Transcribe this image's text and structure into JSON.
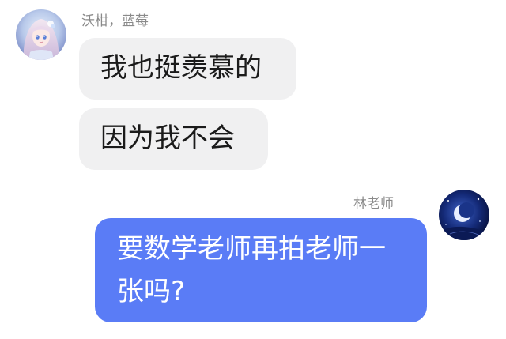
{
  "left_user": {
    "name": "沃柑，蓝莓",
    "avatar_icon": "anime-girl-avatar-icon"
  },
  "right_user": {
    "name": "林老师",
    "avatar_icon": "moon-night-avatar-icon"
  },
  "messages": [
    {
      "side": "left",
      "text": "我也挺羡慕的"
    },
    {
      "side": "left",
      "text": "因为我不会"
    },
    {
      "side": "right",
      "text": "要数学老师再拍老师一张吗?"
    }
  ],
  "colors": {
    "incoming_bubble": "#f0f0f1",
    "outgoing_bubble": "#5a7cf6",
    "sender_name": "#8a8a8a",
    "background": "#ffffff"
  }
}
